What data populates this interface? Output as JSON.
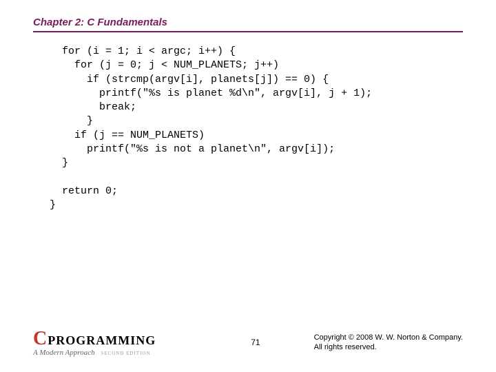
{
  "chapter": {
    "title": "Chapter 2: C Fundamentals"
  },
  "code": {
    "lines": [
      "  for (i = 1; i < argc; i++) {",
      "    for (j = 0; j < NUM_PLANETS; j++)",
      "      if (strcmp(argv[i], planets[j]) == 0) {",
      "        printf(\"%s is planet %d\\n\", argv[i], j + 1);",
      "        break;",
      "      }",
      "    if (j == NUM_PLANETS)",
      "      printf(\"%s is not a planet\\n\", argv[i]);",
      "  }",
      "",
      "  return 0;",
      "}"
    ]
  },
  "footer": {
    "logo_c": "C",
    "logo_text": "PROGRAMMING",
    "logo_sub": "A Modern Approach",
    "logo_edition": "SECOND EDITION",
    "page_number": "71",
    "copyright_line1": "Copyright © 2008 W. W. Norton & Company.",
    "copyright_line2": "All rights reserved."
  }
}
